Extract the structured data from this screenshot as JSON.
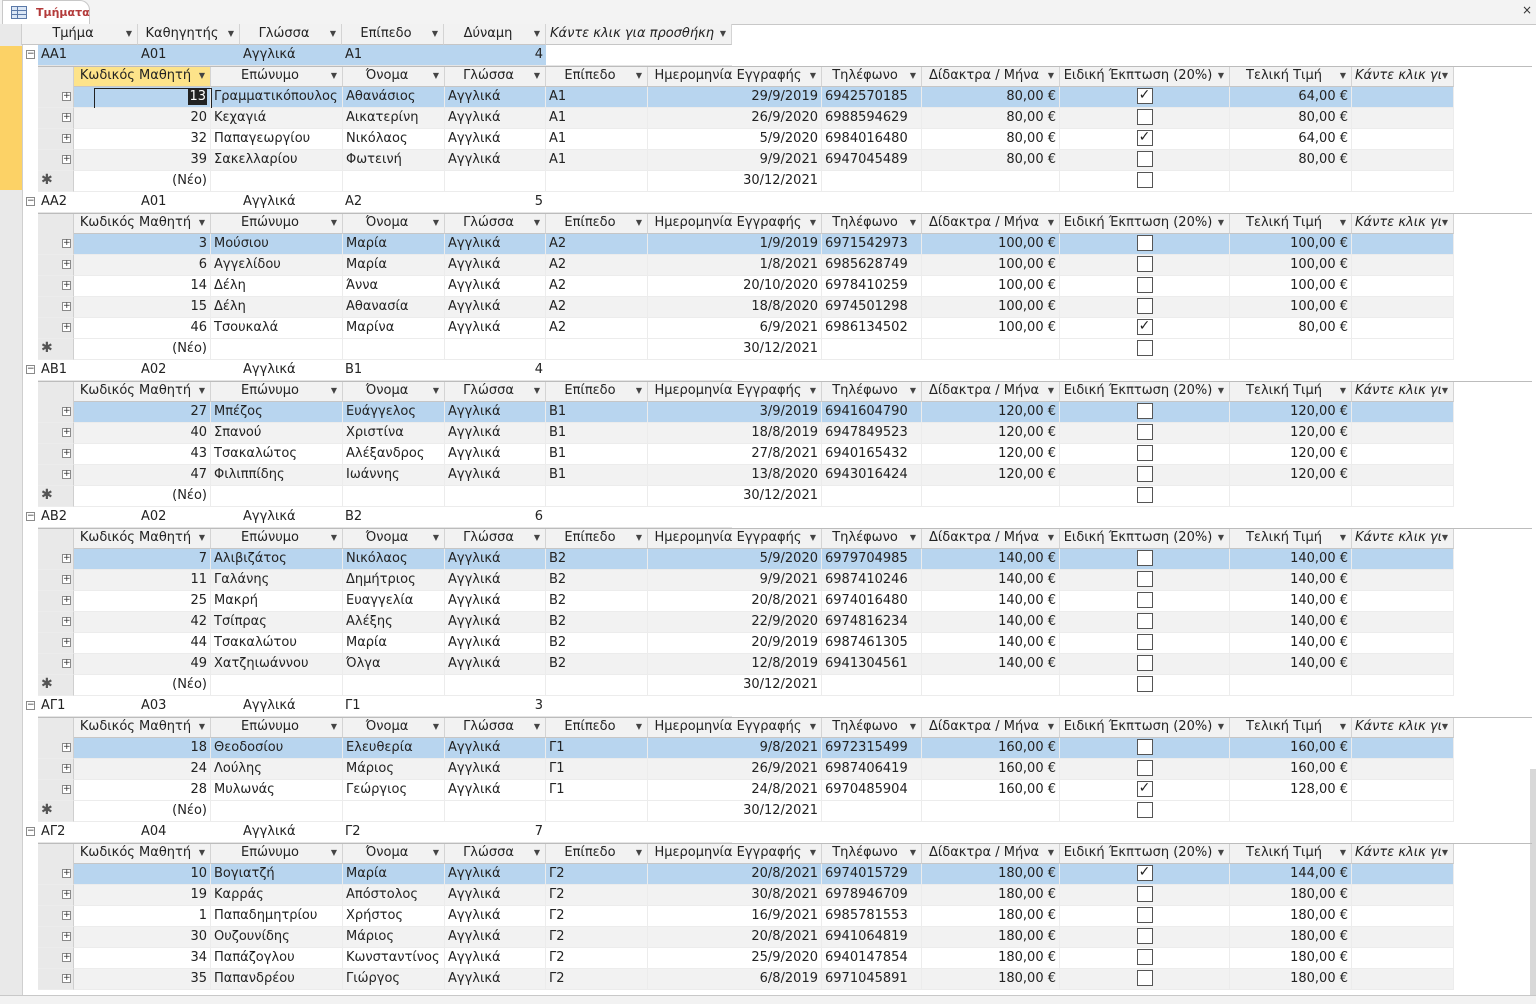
{
  "tab": {
    "label": "Τμήματα",
    "close_glyph": "×"
  },
  "colors": {
    "selection": "#b8d5ef",
    "active_header": "#fde38a",
    "record_bar": "#fcd266",
    "tab_label": "#b33a3a"
  },
  "icons": {
    "tab": "table-icon",
    "expander": "expand-plus-icon",
    "new_record": "asterisk-new-icon",
    "dropdown": "dropdown-arrow-icon",
    "checkbox_tick": "checkmark-icon"
  },
  "parent_columns": [
    "Τμήμα",
    "Καθηγητής",
    "Γλώσσα",
    "Επίπεδο",
    "Δύναμη",
    "Κάντε κλικ για προσθήκη"
  ],
  "child_columns": [
    "Κωδικός Μαθητή",
    "Επώνυμο",
    "Όνομα",
    "Γλώσσα",
    "Επίπεδο",
    "Ημερομηνία Εγγραφής",
    "Τηλέφωνο",
    "Δίδακτρα / Μήνα",
    "Ειδική Έκπτωση (20%)",
    "Τελική Τιμή",
    "Κάντε κλικ γι"
  ],
  "new_row": {
    "label": "(Νέο)",
    "date": "30/12/2021"
  },
  "groups": [
    {
      "tmima": "ΑΑ1",
      "kathigitis": "Α01",
      "glossa": "Αγγλικά",
      "epipedo": "Α1",
      "dynami": "4",
      "students": [
        {
          "id": "13",
          "eponymo": "Γραμματικόπουλος",
          "onoma": "Αθανάσιος",
          "glossa": "Αγγλικά",
          "epipedo": "Α1",
          "date": "29/9/2019",
          "phone": "6942570185",
          "fee": "80,00 €",
          "discount": true,
          "final": "64,00 €"
        },
        {
          "id": "20",
          "eponymo": "Κεχαγιά",
          "onoma": "Αικατερίνη",
          "glossa": "Αγγλικά",
          "epipedo": "Α1",
          "date": "26/9/2020",
          "phone": "6988594629",
          "fee": "80,00 €",
          "discount": false,
          "final": "80,00 €"
        },
        {
          "id": "32",
          "eponymo": "Παπαγεωργίου",
          "onoma": "Νικόλαος",
          "glossa": "Αγγλικά",
          "epipedo": "Α1",
          "date": "5/9/2020",
          "phone": "6984016480",
          "fee": "80,00 €",
          "discount": true,
          "final": "64,00 €"
        },
        {
          "id": "39",
          "eponymo": "Σακελλαρίου",
          "onoma": "Φωτεινή",
          "glossa": "Αγγλικά",
          "epipedo": "Α1",
          "date": "9/9/2021",
          "phone": "6947045489",
          "fee": "80,00 €",
          "discount": false,
          "final": "80,00 €"
        }
      ]
    },
    {
      "tmima": "ΑΑ2",
      "kathigitis": "Α01",
      "glossa": "Αγγλικά",
      "epipedo": "Α2",
      "dynami": "5",
      "students": [
        {
          "id": "3",
          "eponymo": "Μούσιου",
          "onoma": "Μαρία",
          "glossa": "Αγγλικά",
          "epipedo": "Α2",
          "date": "1/9/2019",
          "phone": "6971542973",
          "fee": "100,00 €",
          "discount": false,
          "final": "100,00 €"
        },
        {
          "id": "6",
          "eponymo": "Αγγελίδου",
          "onoma": "Μαρία",
          "glossa": "Αγγλικά",
          "epipedo": "Α2",
          "date": "1/8/2021",
          "phone": "6985628749",
          "fee": "100,00 €",
          "discount": false,
          "final": "100,00 €"
        },
        {
          "id": "14",
          "eponymo": "Δέλη",
          "onoma": "Άννα",
          "glossa": "Αγγλικά",
          "epipedo": "Α2",
          "date": "20/10/2020",
          "phone": "6978410259",
          "fee": "100,00 €",
          "discount": false,
          "final": "100,00 €"
        },
        {
          "id": "15",
          "eponymo": "Δέλη",
          "onoma": "Αθανασία",
          "glossa": "Αγγλικά",
          "epipedo": "Α2",
          "date": "18/8/2020",
          "phone": "6974501298",
          "fee": "100,00 €",
          "discount": false,
          "final": "100,00 €"
        },
        {
          "id": "46",
          "eponymo": "Τσουκαλά",
          "onoma": "Μαρίνα",
          "glossa": "Αγγλικά",
          "epipedo": "Α2",
          "date": "6/9/2021",
          "phone": "6986134502",
          "fee": "100,00 €",
          "discount": true,
          "final": "80,00 €"
        }
      ]
    },
    {
      "tmima": "ΑΒ1",
      "kathigitis": "Α02",
      "glossa": "Αγγλικά",
      "epipedo": "Β1",
      "dynami": "4",
      "students": [
        {
          "id": "27",
          "eponymo": "Μπέζος",
          "onoma": "Ευάγγελος",
          "glossa": "Αγγλικά",
          "epipedo": "Β1",
          "date": "3/9/2019",
          "phone": "6941604790",
          "fee": "120,00 €",
          "discount": false,
          "final": "120,00 €"
        },
        {
          "id": "40",
          "eponymo": "Σπανού",
          "onoma": "Χριστίνα",
          "glossa": "Αγγλικά",
          "epipedo": "Β1",
          "date": "18/8/2019",
          "phone": "6947849523",
          "fee": "120,00 €",
          "discount": false,
          "final": "120,00 €"
        },
        {
          "id": "43",
          "eponymo": "Τσακαλώτος",
          "onoma": "Αλέξανδρος",
          "glossa": "Αγγλικά",
          "epipedo": "Β1",
          "date": "27/8/2021",
          "phone": "6940165432",
          "fee": "120,00 €",
          "discount": false,
          "final": "120,00 €"
        },
        {
          "id": "47",
          "eponymo": "Φιλιππίδης",
          "onoma": "Ιωάννης",
          "glossa": "Αγγλικά",
          "epipedo": "Β1",
          "date": "13/8/2020",
          "phone": "6943016424",
          "fee": "120,00 €",
          "discount": false,
          "final": "120,00 €"
        }
      ]
    },
    {
      "tmima": "ΑΒ2",
      "kathigitis": "Α02",
      "glossa": "Αγγλικά",
      "epipedo": "Β2",
      "dynami": "6",
      "students": [
        {
          "id": "7",
          "eponymo": "Αλιβιζάτος",
          "onoma": "Νικόλαος",
          "glossa": "Αγγλικά",
          "epipedo": "Β2",
          "date": "5/9/2020",
          "phone": "6979704985",
          "fee": "140,00 €",
          "discount": false,
          "final": "140,00 €"
        },
        {
          "id": "11",
          "eponymo": "Γαλάνης",
          "onoma": "Δημήτριος",
          "glossa": "Αγγλικά",
          "epipedo": "Β2",
          "date": "9/9/2021",
          "phone": "6987410246",
          "fee": "140,00 €",
          "discount": false,
          "final": "140,00 €"
        },
        {
          "id": "25",
          "eponymo": "Μακρή",
          "onoma": "Ευαγγελία",
          "glossa": "Αγγλικά",
          "epipedo": "Β2",
          "date": "20/8/2021",
          "phone": "6974016480",
          "fee": "140,00 €",
          "discount": false,
          "final": "140,00 €"
        },
        {
          "id": "42",
          "eponymo": "Τσίπρας",
          "onoma": "Αλέξης",
          "glossa": "Αγγλικά",
          "epipedo": "Β2",
          "date": "22/9/2020",
          "phone": "6974816234",
          "fee": "140,00 €",
          "discount": false,
          "final": "140,00 €"
        },
        {
          "id": "44",
          "eponymo": "Τσακαλώτου",
          "onoma": "Μαρία",
          "glossa": "Αγγλικά",
          "epipedo": "Β2",
          "date": "20/9/2019",
          "phone": "6987461305",
          "fee": "140,00 €",
          "discount": false,
          "final": "140,00 €"
        },
        {
          "id": "49",
          "eponymo": "Χατζηιωάννου",
          "onoma": "Όλγα",
          "glossa": "Αγγλικά",
          "epipedo": "Β2",
          "date": "12/8/2019",
          "phone": "6941304561",
          "fee": "140,00 €",
          "discount": false,
          "final": "140,00 €"
        }
      ]
    },
    {
      "tmima": "ΑΓ1",
      "kathigitis": "Α03",
      "glossa": "Αγγλικά",
      "epipedo": "Γ1",
      "dynami": "3",
      "students": [
        {
          "id": "18",
          "eponymo": "Θεοδοσίου",
          "onoma": "Ελευθερία",
          "glossa": "Αγγλικά",
          "epipedo": "Γ1",
          "date": "9/8/2021",
          "phone": "6972315499",
          "fee": "160,00 €",
          "discount": false,
          "final": "160,00 €"
        },
        {
          "id": "24",
          "eponymo": "Λούλης",
          "onoma": "Μάριος",
          "glossa": "Αγγλικά",
          "epipedo": "Γ1",
          "date": "26/9/2021",
          "phone": "6987406419",
          "fee": "160,00 €",
          "discount": false,
          "final": "160,00 €"
        },
        {
          "id": "28",
          "eponymo": "Μυλωνάς",
          "onoma": "Γεώργιος",
          "glossa": "Αγγλικά",
          "epipedo": "Γ1",
          "date": "24/8/2021",
          "phone": "6970485904",
          "fee": "160,00 €",
          "discount": true,
          "final": "128,00 €"
        }
      ]
    },
    {
      "tmima": "ΑΓ2",
      "kathigitis": "Α04",
      "glossa": "Αγγλικά",
      "epipedo": "Γ2",
      "dynami": "7",
      "students": [
        {
          "id": "10",
          "eponymo": "Βογιατζή",
          "onoma": "Μαρία",
          "glossa": "Αγγλικά",
          "epipedo": "Γ2",
          "date": "20/8/2021",
          "phone": "6974015729",
          "fee": "180,00 €",
          "discount": true,
          "final": "144,00 €"
        },
        {
          "id": "19",
          "eponymo": "Καρράς",
          "onoma": "Απόστολος",
          "glossa": "Αγγλικά",
          "epipedo": "Γ2",
          "date": "30/8/2021",
          "phone": "6978946709",
          "fee": "180,00 €",
          "discount": false,
          "final": "180,00 €"
        },
        {
          "id": "1",
          "eponymo": "Παπαδημητρίου",
          "onoma": "Χρήστος",
          "glossa": "Αγγλικά",
          "epipedo": "Γ2",
          "date": "16/9/2021",
          "phone": "6985781553",
          "fee": "180,00 €",
          "discount": false,
          "final": "180,00 €"
        },
        {
          "id": "30",
          "eponymo": "Ουζουνίδης",
          "onoma": "Μάριος",
          "glossa": "Αγγλικά",
          "epipedo": "Γ2",
          "date": "20/8/2021",
          "phone": "6941064819",
          "fee": "180,00 €",
          "discount": false,
          "final": "180,00 €"
        },
        {
          "id": "34",
          "eponymo": "Παπάζογλου",
          "onoma": "Κωνσταντίνος",
          "glossa": "Αγγλικά",
          "epipedo": "Γ2",
          "date": "25/9/2020",
          "phone": "6940147854",
          "fee": "180,00 €",
          "discount": false,
          "final": "180,00 €"
        },
        {
          "id": "35",
          "eponymo": "Παπανδρέου",
          "onoma": "Γιώργος",
          "glossa": "Αγγλικά",
          "epipedo": "Γ2",
          "date": "6/8/2019",
          "phone": "6971045891",
          "fee": "180,00 €",
          "discount": false,
          "final": "180,00 €"
        }
      ]
    }
  ]
}
